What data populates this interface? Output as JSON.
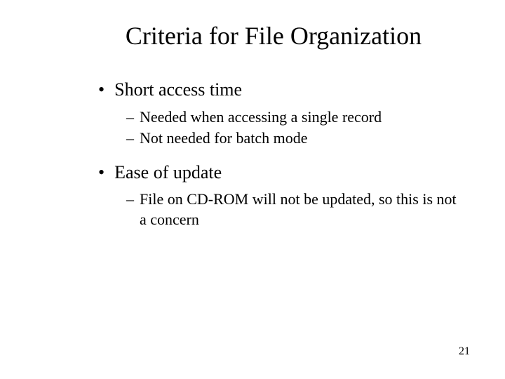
{
  "title": "Criteria for File Organization",
  "bullets": [
    {
      "text": "Short access time",
      "subs": [
        "Needed when accessing a single record",
        "Not needed for batch mode"
      ]
    },
    {
      "text": "Ease of update",
      "subs": [
        "File on CD-ROM will not be updated, so this is not a concern"
      ]
    }
  ],
  "pageNumber": "21"
}
